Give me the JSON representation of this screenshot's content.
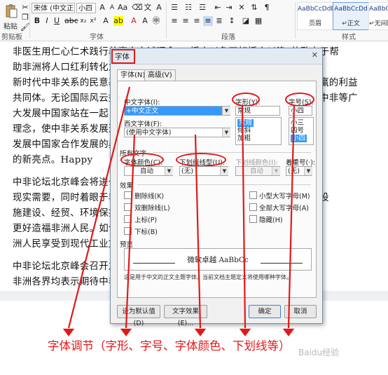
{
  "ribbon": {
    "clipboard_label": "粘贴",
    "clipboard_group": "剪贴板",
    "font_name": "宋体 (中文正",
    "font_size": "小四",
    "font_group": "字体",
    "paragraph_group": "段落",
    "styles_group": "样式",
    "styles": [
      {
        "sample": "AaBbCcDdE",
        "name": "页眉"
      },
      {
        "sample": "AaBbCcDd",
        "name": "↵正文"
      },
      {
        "sample": "AaBbCcDd",
        "name": "↵无间隔"
      }
    ]
  },
  "document": {
    "lines": [
      "非医生用仁心仁术践行着真实亲诚理念，“授人以鱼不如授人以渔”的致力于帮",
      "助非洲将人口红利转化为发展红利，实现自主可持续发展，筑牢了",
      "新时代中非关系的民意基础，打造了更加紧密的中非命运共同体，互利共赢的利益",
      "共同体。无论国际风云如何变幻，中国都将坚定不移地同非洲站在一起，中非等广",
      "大发展中国家站在一起，打造平等互信、合作共赢，中国对非外交",
      "理念，使中非关系发展迈上新台阶，行动推动中非关系发展，成为",
      "发展中国家合作发展的典范，中国对非外交理念成为推动中非合作关系",
      "的新亮点。Happy",
      "    中非论坛北京峰会将进一步推动中非合作，符合非洲国家发展的",
      "现实需要，同时着眼于非洲长远发展，为非洲工业化、农业现代化、基础设",
      "施建设、经贸、环境保护、人文交流等领域合作提出新的合作举措，",
      "更好造福非洲人民。如今的中国已经有能力，也有意愿，帮助非",
      "洲人民享受到现代工业文明带来的实惠。",
      "    中非论坛北京峰会召开之际，多位非洲国家领导人将来华访非后，",
      "非洲各界均表示期待中非合作论坛北京峰会召开，期待峰会推出的新"
    ]
  },
  "dialog": {
    "title": "字体",
    "tab_font": "字体(N)",
    "tab_advanced": "高级(V)",
    "chinese_font_label": "中文字体(I):",
    "chinese_font_value": "+中文正文",
    "western_font_label": "西文字体(F):",
    "western_font_value": "(使用中文字体)",
    "style_label": "字形(Y):",
    "style_value": "常规",
    "style_options": [
      "常规",
      "倾斜",
      "加粗"
    ],
    "size_label": "字号(S):",
    "size_value": "小四",
    "size_options": [
      "小三",
      "四号",
      "小四"
    ],
    "all_text_label": "所有文字",
    "font_color_label": "字体颜色(C):",
    "font_color_value": "自动",
    "underline_label": "下划线线型(U):",
    "underline_value": "(无)",
    "underline_color_label": "下划线颜色(I):",
    "underline_color_value": "自动",
    "emphasis_label": "着重号(·):",
    "emphasis_value": "(无)",
    "effects_label": "效果",
    "effects_left": [
      "删除线(K)",
      "双删除线(L)",
      "上标(P)",
      "下标(B)"
    ],
    "effects_right": [
      "小型大写字母(M)",
      "全部大写字母(A)",
      "隐藏(H)"
    ],
    "preview_label": "预览",
    "preview_text": "微软卓越  AaBbCc",
    "preview_note": "这是用于中文的正文主题字体。当前文档主题定义将使用哪种字体。",
    "btn_default": "设为默认值(D)",
    "btn_effects": "文字效果(E)...",
    "btn_ok": "确定",
    "btn_cancel": "取消"
  },
  "annotation": {
    "caption": "字体调节（字形、字号、字体颜色、下划线等）",
    "color": "#e21818"
  },
  "watermark": "Baidu经验"
}
